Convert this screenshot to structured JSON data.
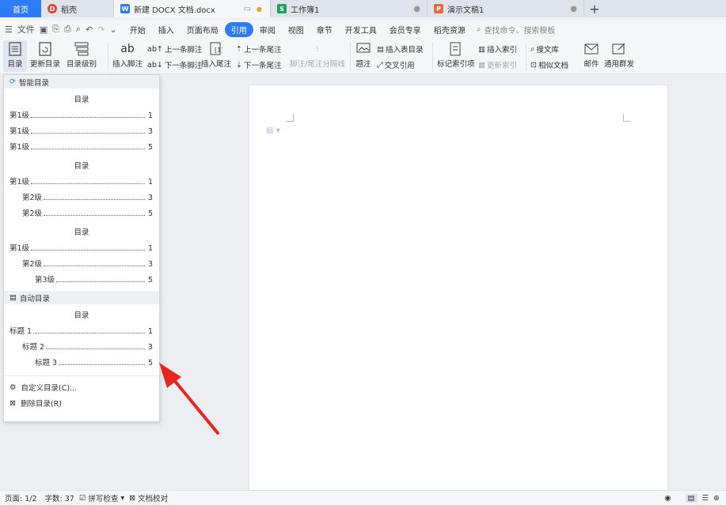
{
  "tabs": {
    "home": "首页",
    "items": [
      {
        "label": "稻壳",
        "icon": "daoke-icon",
        "color": "#e8413c"
      },
      {
        "label": "新建 DOCX 文档.docx",
        "icon": "writer-icon",
        "color": "#2d7cf6"
      },
      {
        "label": "工作簿1",
        "icon": "spreadsheet-icon",
        "color": "#1aa260"
      },
      {
        "label": "演示文稿1",
        "icon": "presentation-icon",
        "color": "#e8683c"
      }
    ]
  },
  "menu": {
    "file": "文件",
    "items": [
      "开始",
      "插入",
      "页面布局",
      "引用",
      "审阅",
      "视图",
      "章节",
      "开发工具",
      "会员专享",
      "稻壳资源"
    ],
    "active": "引用",
    "search_placeholder": "查找命令、搜索模板"
  },
  "ribbon": {
    "toc": "目录",
    "update_toc": "更新目录",
    "toc_level": "目录级别",
    "insert_footnote": "插入脚注",
    "prev_footnote": "上一条脚注",
    "next_footnote": "下一条脚注",
    "insert_endnote": "插入尾注",
    "prev_endnote": "上一条尾注",
    "next_endnote": "下一条尾注",
    "separator": "脚注/尾注分隔线",
    "caption": "题注",
    "insert_table_toc": "插入表目录",
    "cross_ref": "交叉引用",
    "mark_index": "标记索引项",
    "insert_index": "插入索引",
    "update_index": "更新索引",
    "search_library": "搜文库",
    "similar_docs": "相似文档",
    "mail": "邮件",
    "mass_send": "通用群发"
  },
  "toc_menu": {
    "smart_header": "智能目录",
    "smart_toc": [
      {
        "title": "目录",
        "lines": [
          {
            "label": "第1级",
            "page": "1",
            "indent": 0
          },
          {
            "label": "第1级",
            "page": "3",
            "indent": 0
          },
          {
            "label": "第1级",
            "page": "5",
            "indent": 0
          }
        ]
      },
      {
        "title": "目录",
        "lines": [
          {
            "label": "第1级",
            "page": "1",
            "indent": 0
          },
          {
            "label": "第2级",
            "page": "3",
            "indent": 1
          },
          {
            "label": "第2级",
            "page": "5",
            "indent": 1
          }
        ]
      },
      {
        "title": "目录",
        "lines": [
          {
            "label": "第1级",
            "page": "1",
            "indent": 0
          },
          {
            "label": "第2级",
            "page": "3",
            "indent": 1
          },
          {
            "label": "第3级",
            "page": "5",
            "indent": 2
          }
        ]
      }
    ],
    "auto_header": "自动目录",
    "auto_toc": {
      "title": "目录",
      "lines": [
        {
          "label": "标题 1",
          "page": "1",
          "indent": 0
        },
        {
          "label": "标题 2",
          "page": "3",
          "indent": 1
        },
        {
          "label": "标题 3",
          "page": "5",
          "indent": 2
        }
      ]
    },
    "custom": "自定义目录(C)...",
    "delete": "删除目录(R)"
  },
  "status": {
    "page": "页面: 1/2",
    "words": "字数: 37",
    "spell": "拼写检查",
    "proof": "文档校对"
  },
  "colors": {
    "accent": "#2d7cf6",
    "arrow": "#e8261f"
  }
}
